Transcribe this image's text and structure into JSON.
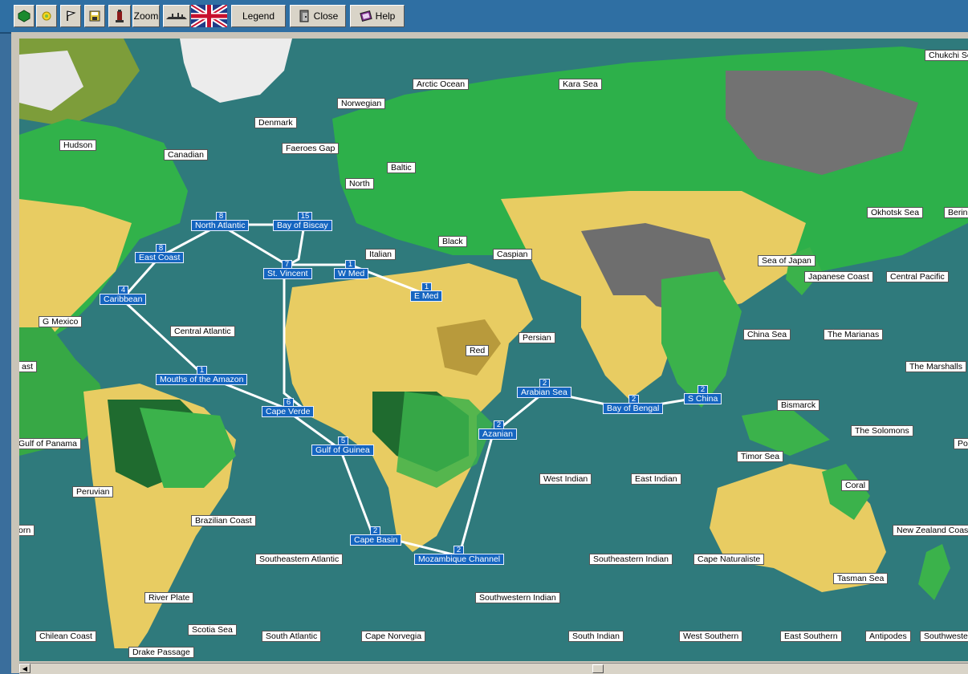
{
  "toolbar": {
    "zoom_label": "Zoom",
    "legend_label": "Legend",
    "close_label": "Close",
    "help_label": "Help"
  },
  "colors": {
    "ocean": "#2f7a7c",
    "route": "#1565c0"
  },
  "sea_zones": [
    "Chukchi Se",
    "Arctic Ocean",
    "Kara Sea",
    "Norwegian",
    "Hudson",
    "Denmark",
    "Faeroes Gap",
    "Canadian",
    "Baltic",
    "North",
    "Black",
    "Caspian",
    "Italian",
    "Okhotsk Sea",
    "Berin",
    "Sea of Japan",
    "Japanese Coast",
    "Central Pacific",
    "G Mexico",
    "Central Atlantic",
    "Persian",
    "Red",
    "China Sea",
    "The Marianas",
    "ast",
    "The Marshalls",
    "Bismarck",
    "Gulf of Panama",
    "The Solomons",
    "Po",
    "Timor Sea",
    "Peruvian",
    "West Indian",
    "East Indian",
    "Coral",
    "Brazilian Coast",
    "orn",
    "New Zealand Coas",
    "Southeastern Atlantic",
    "Southeastern Indian",
    "Cape Naturaliste",
    "Tasman Sea",
    "River Plate",
    "Southwestern Indian",
    "Scotia Sea",
    "Chilean Coast",
    "South Atlantic",
    "Cape Norvegia",
    "South Indian",
    "West Southern",
    "East Southern",
    "Antipodes",
    "Southweste",
    "Drake Passage"
  ],
  "routes": [
    {
      "name": "North Atlantic",
      "count": "8"
    },
    {
      "name": "Bay of Biscay",
      "count": "15"
    },
    {
      "name": "East Coast",
      "count": "8"
    },
    {
      "name": "St. Vincent",
      "count": "7"
    },
    {
      "name": "W Med",
      "count": "1"
    },
    {
      "name": "E Med",
      "count": "1"
    },
    {
      "name": "Caribbean",
      "count": "4"
    },
    {
      "name": "Mouths of the Amazon",
      "count": "1"
    },
    {
      "name": "Cape Verde",
      "count": "6"
    },
    {
      "name": "Gulf of Guinea",
      "count": "5"
    },
    {
      "name": "Azanian",
      "count": "2"
    },
    {
      "name": "Arabian Sea",
      "count": "2"
    },
    {
      "name": "Bay of Bengal",
      "count": "2"
    },
    {
      "name": "S China",
      "count": "2"
    },
    {
      "name": "Cape Basin",
      "count": "2"
    },
    {
      "name": "Mozambique Channel",
      "count": "2"
    }
  ]
}
